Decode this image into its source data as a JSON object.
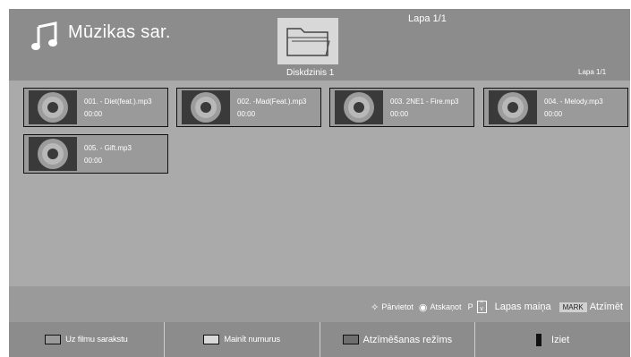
{
  "header": {
    "title": "Mūzikas sar.",
    "top_page": "Lapa 1/1",
    "drive": "Diskdzinis 1",
    "right_page": "Lapa 1/1",
    "icon": "music-note-icon",
    "folder_icon": "folder-icon"
  },
  "files": [
    {
      "name": "001. - Diet(feat.).mp3",
      "time": "00:00"
    },
    {
      "name": "002. -Mad(Feat.).mp3",
      "time": "00:00"
    },
    {
      "name": "003. 2NE1 - Fire.mp3",
      "time": "00:00"
    },
    {
      "name": "004. - Melody.mp3",
      "time": "00:00"
    },
    {
      "name": "005. - Gift.mp3",
      "time": "00:00"
    }
  ],
  "hints": {
    "move": "Pārvietot",
    "view": "Atskaņot",
    "p": "P",
    "page_change": "Lapas maiņa",
    "mark_key": "MARK",
    "mark": "Atzīmēt"
  },
  "bottom": {
    "red": "Uz filmu sarakstu",
    "green": "Mainīt numurus",
    "yellow": "Atzīmēšanas režīms",
    "exit": "Iziet"
  },
  "colors": {
    "background": "#a3a3a3",
    "header": "#8c8c8c",
    "red_swatch": "#9a9a9a",
    "green_swatch": "#d9d9d9",
    "yellow_swatch": "#6e6e6e"
  }
}
